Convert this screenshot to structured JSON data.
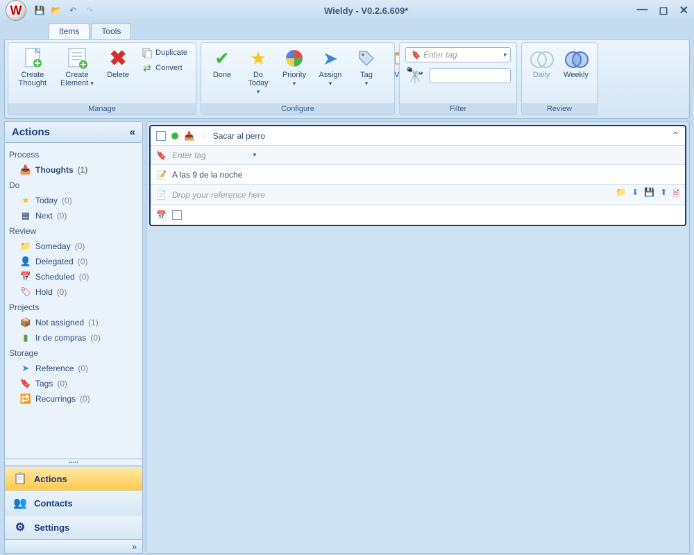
{
  "title": "Wieldy - V0.2.6.609*",
  "tabs": {
    "items": "Items",
    "tools": "Tools"
  },
  "ribbon": {
    "manage": {
      "label": "Manage",
      "create_thought": "Create Thought",
      "create_element": "Create Element",
      "delete": "Delete",
      "duplicate": "Duplicate",
      "convert": "Convert"
    },
    "configure": {
      "label": "Configure",
      "done": "Done",
      "do_today": "Do Today",
      "priority": "Priority",
      "assign": "Assign",
      "tag": "Tag",
      "view": "View"
    },
    "filter": {
      "label": "Filter",
      "enter_tag": "Enter tag"
    },
    "review": {
      "label": "Review",
      "daily": "Daily",
      "weekly": "Weekly"
    }
  },
  "sidebar": {
    "title": "Actions",
    "process": {
      "label": "Process",
      "thoughts": "Thoughts",
      "thoughts_count": "(1)"
    },
    "do": {
      "label": "Do",
      "today": "Today",
      "today_count": "(0)",
      "next": "Next",
      "next_count": "(0)"
    },
    "review": {
      "label": "Review",
      "someday": "Someday",
      "someday_count": "(0)",
      "delegated": "Delegated",
      "delegated_count": "(0)",
      "scheduled": "Scheduled",
      "scheduled_count": "(0)",
      "hold": "Hold",
      "hold_count": "(0)"
    },
    "projects": {
      "label": "Projects",
      "not_assigned": "Not assigned",
      "not_assigned_count": "(1)",
      "ir_de_compras": "Ir de compras",
      "ir_de_compras_count": "(0)"
    },
    "storage": {
      "label": "Storage",
      "reference": "Reference",
      "reference_count": "(0)",
      "tags": "Tags",
      "tags_count": "(0)",
      "recurrings": "Recurrings",
      "recurrings_count": "(0)"
    },
    "nav": {
      "actions": "Actions",
      "contacts": "Contacts",
      "settings": "Settings"
    }
  },
  "item": {
    "title": "Sacar al perro",
    "enter_tag": "Enter tag",
    "note": "A las 9 de la noche",
    "drop_ref": "Drop your reference here"
  }
}
